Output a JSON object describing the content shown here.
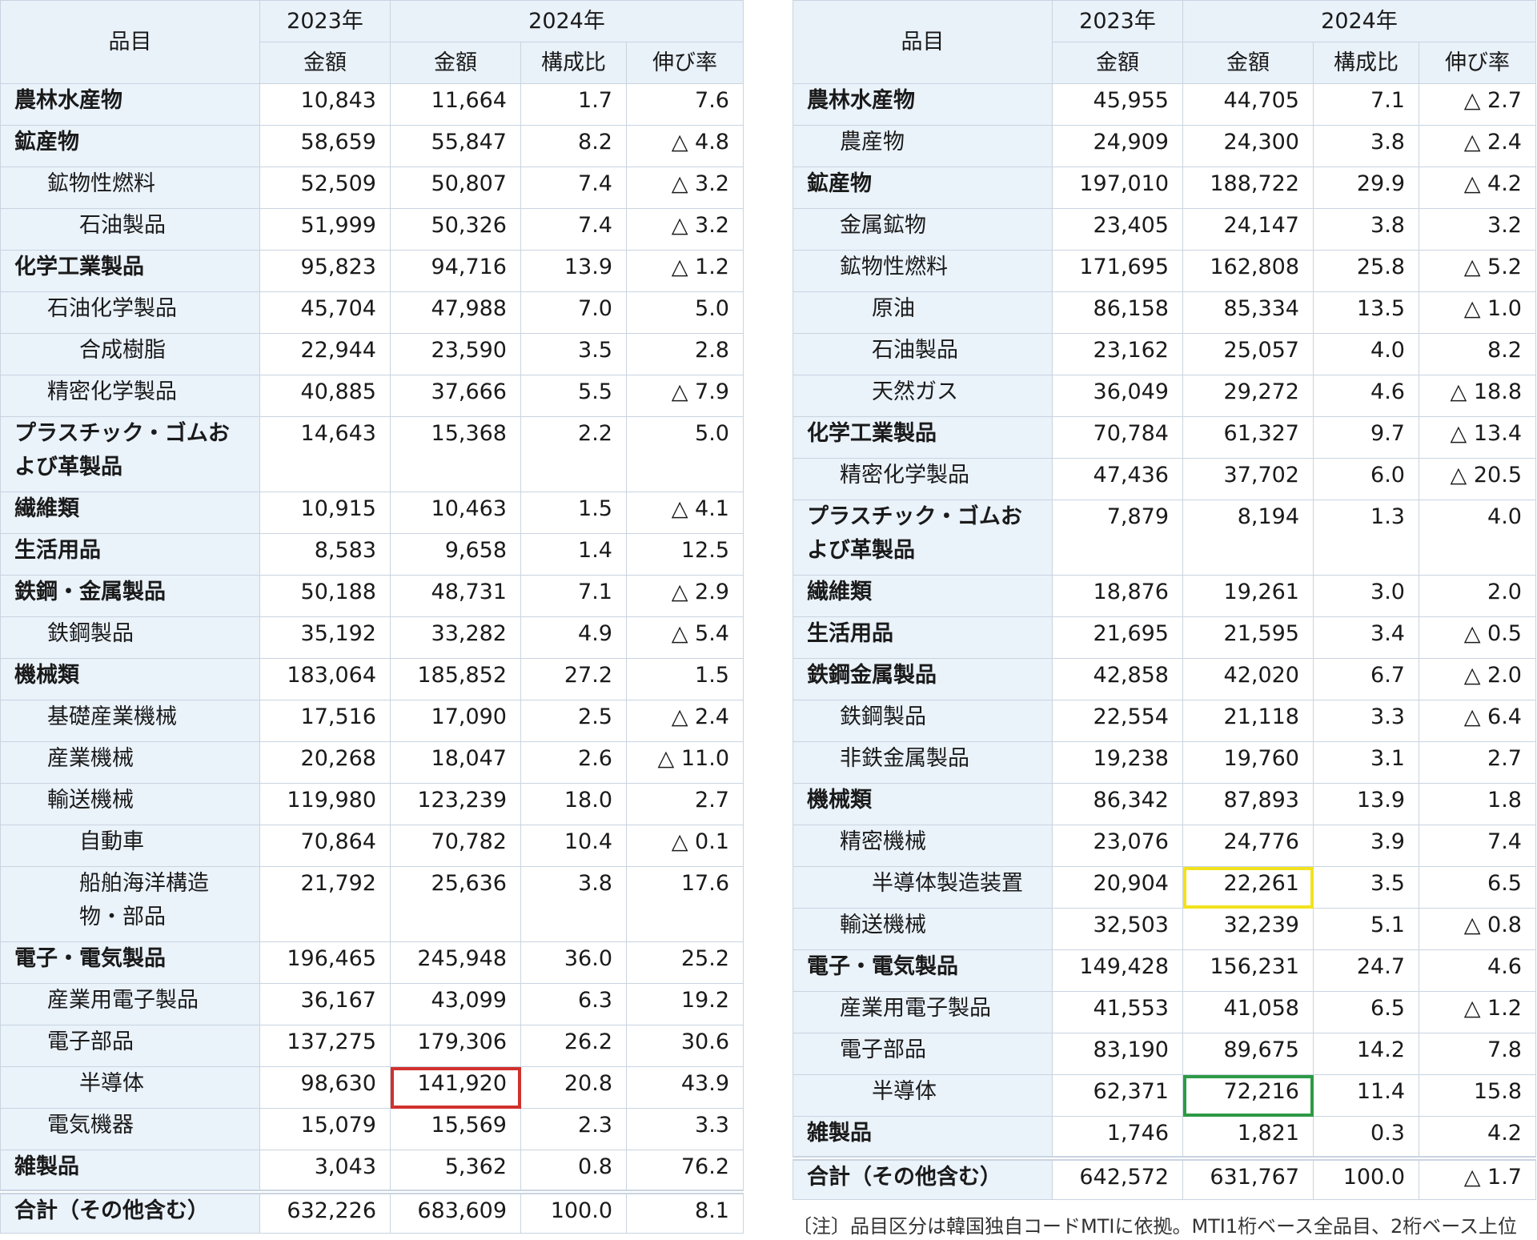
{
  "headers": {
    "item": "品目",
    "year_prev": "2023年",
    "year_curr": "2024年",
    "amount": "金額",
    "share": "構成比",
    "growth": "伸び率"
  },
  "left_table": {
    "rows": [
      {
        "name": "農林水産物",
        "level": 0,
        "v2023": "10,843",
        "v2024": "11,664",
        "share": "1.7",
        "growth": "7.6"
      },
      {
        "name": "鉱産物",
        "level": 0,
        "v2023": "58,659",
        "v2024": "55,847",
        "share": "8.2",
        "growth": "△ 4.8"
      },
      {
        "name": "鉱物性燃料",
        "level": 1,
        "v2023": "52,509",
        "v2024": "50,807",
        "share": "7.4",
        "growth": "△ 3.2"
      },
      {
        "name": "石油製品",
        "level": 2,
        "v2023": "51,999",
        "v2024": "50,326",
        "share": "7.4",
        "growth": "△ 3.2"
      },
      {
        "name": "化学工業製品",
        "level": 0,
        "v2023": "95,823",
        "v2024": "94,716",
        "share": "13.9",
        "growth": "△ 1.2"
      },
      {
        "name": "石油化学製品",
        "level": 1,
        "v2023": "45,704",
        "v2024": "47,988",
        "share": "7.0",
        "growth": "5.0"
      },
      {
        "name": "合成樹脂",
        "level": 2,
        "v2023": "22,944",
        "v2024": "23,590",
        "share": "3.5",
        "growth": "2.8"
      },
      {
        "name": "精密化学製品",
        "level": 1,
        "v2023": "40,885",
        "v2024": "37,666",
        "share": "5.5",
        "growth": "△ 7.9"
      },
      {
        "name": "プラスチック・ゴムおよび革製品",
        "level": 0,
        "v2023": "14,643",
        "v2024": "15,368",
        "share": "2.2",
        "growth": "5.0",
        "tall": true
      },
      {
        "name": "繊維類",
        "level": 0,
        "v2023": "10,915",
        "v2024": "10,463",
        "share": "1.5",
        "growth": "△ 4.1"
      },
      {
        "name": "生活用品",
        "level": 0,
        "v2023": "8,583",
        "v2024": "9,658",
        "share": "1.4",
        "growth": "12.5"
      },
      {
        "name": "鉄鋼・金属製品",
        "level": 0,
        "v2023": "50,188",
        "v2024": "48,731",
        "share": "7.1",
        "growth": "△ 2.9"
      },
      {
        "name": "鉄鋼製品",
        "level": 1,
        "v2023": "35,192",
        "v2024": "33,282",
        "share": "4.9",
        "growth": "△ 5.4"
      },
      {
        "name": "機械類",
        "level": 0,
        "v2023": "183,064",
        "v2024": "185,852",
        "share": "27.2",
        "growth": "1.5"
      },
      {
        "name": "基礎産業機械",
        "level": 1,
        "v2023": "17,516",
        "v2024": "17,090",
        "share": "2.5",
        "growth": "△ 2.4"
      },
      {
        "name": "産業機械",
        "level": 1,
        "v2023": "20,268",
        "v2024": "18,047",
        "share": "2.6",
        "growth": "△ 11.0"
      },
      {
        "name": "輸送機械",
        "level": 1,
        "v2023": "119,980",
        "v2024": "123,239",
        "share": "18.0",
        "growth": "2.7"
      },
      {
        "name": "自動車",
        "level": 2,
        "v2023": "70,864",
        "v2024": "70,782",
        "share": "10.4",
        "growth": "△ 0.1"
      },
      {
        "name": "船舶海洋構造物・部品",
        "level": 2,
        "v2023": "21,792",
        "v2024": "25,636",
        "share": "3.8",
        "growth": "17.6",
        "tall": true
      },
      {
        "name": "電子・電気製品",
        "level": 0,
        "v2023": "196,465",
        "v2024": "245,948",
        "share": "36.0",
        "growth": "25.2"
      },
      {
        "name": "産業用電子製品",
        "level": 1,
        "v2023": "36,167",
        "v2024": "43,099",
        "share": "6.3",
        "growth": "19.2"
      },
      {
        "name": "電子部品",
        "level": 1,
        "v2023": "137,275",
        "v2024": "179,306",
        "share": "26.2",
        "growth": "30.6"
      },
      {
        "name": "半導体",
        "level": 2,
        "v2023": "98,630",
        "v2024": "141,920",
        "share": "20.8",
        "growth": "43.9",
        "highlight": "red"
      },
      {
        "name": "電気機器",
        "level": 1,
        "v2023": "15,079",
        "v2024": "15,569",
        "share": "2.3",
        "growth": "3.3"
      },
      {
        "name": "雑製品",
        "level": 0,
        "v2023": "3,043",
        "v2024": "5,362",
        "share": "0.8",
        "growth": "76.2"
      }
    ],
    "total": {
      "name": "合計（その他含む）",
      "v2023": "632,226",
      "v2024": "683,609",
      "share": "100.0",
      "growth": "8.1"
    }
  },
  "right_table": {
    "rows": [
      {
        "name": "農林水産物",
        "level": 0,
        "v2023": "45,955",
        "v2024": "44,705",
        "share": "7.1",
        "growth": "△ 2.7"
      },
      {
        "name": "農産物",
        "level": 1,
        "v2023": "24,909",
        "v2024": "24,300",
        "share": "3.8",
        "growth": "△ 2.4"
      },
      {
        "name": "鉱産物",
        "level": 0,
        "v2023": "197,010",
        "v2024": "188,722",
        "share": "29.9",
        "growth": "△ 4.2"
      },
      {
        "name": "金属鉱物",
        "level": 1,
        "v2023": "23,405",
        "v2024": "24,147",
        "share": "3.8",
        "growth": "3.2"
      },
      {
        "name": "鉱物性燃料",
        "level": 1,
        "v2023": "171,695",
        "v2024": "162,808",
        "share": "25.8",
        "growth": "△ 5.2"
      },
      {
        "name": "原油",
        "level": 2,
        "v2023": "86,158",
        "v2024": "85,334",
        "share": "13.5",
        "growth": "△ 1.0"
      },
      {
        "name": "石油製品",
        "level": 2,
        "v2023": "23,162",
        "v2024": "25,057",
        "share": "4.0",
        "growth": "8.2"
      },
      {
        "name": "天然ガス",
        "level": 2,
        "v2023": "36,049",
        "v2024": "29,272",
        "share": "4.6",
        "growth": "△ 18.8"
      },
      {
        "name": "化学工業製品",
        "level": 0,
        "v2023": "70,784",
        "v2024": "61,327",
        "share": "9.7",
        "growth": "△ 13.4"
      },
      {
        "name": "精密化学製品",
        "level": 1,
        "v2023": "47,436",
        "v2024": "37,702",
        "share": "6.0",
        "growth": "△ 20.5"
      },
      {
        "name": "プラスチック・ゴムおよび革製品",
        "level": 0,
        "v2023": "7,879",
        "v2024": "8,194",
        "share": "1.3",
        "growth": "4.0",
        "tall": true
      },
      {
        "name": "繊維類",
        "level": 0,
        "v2023": "18,876",
        "v2024": "19,261",
        "share": "3.0",
        "growth": "2.0"
      },
      {
        "name": "生活用品",
        "level": 0,
        "v2023": "21,695",
        "v2024": "21,595",
        "share": "3.4",
        "growth": "△ 0.5"
      },
      {
        "name": "鉄鋼金属製品",
        "level": 0,
        "v2023": "42,858",
        "v2024": "42,020",
        "share": "6.7",
        "growth": "△ 2.0"
      },
      {
        "name": "鉄鋼製品",
        "level": 1,
        "v2023": "22,554",
        "v2024": "21,118",
        "share": "3.3",
        "growth": "△ 6.4"
      },
      {
        "name": "非鉄金属製品",
        "level": 1,
        "v2023": "19,238",
        "v2024": "19,760",
        "share": "3.1",
        "growth": "2.7"
      },
      {
        "name": "機械類",
        "level": 0,
        "v2023": "86,342",
        "v2024": "87,893",
        "share": "13.9",
        "growth": "1.8"
      },
      {
        "name": "精密機械",
        "level": 1,
        "v2023": "23,076",
        "v2024": "24,776",
        "share": "3.9",
        "growth": "7.4"
      },
      {
        "name": "半導体製造装置",
        "level": 2,
        "v2023": "20,904",
        "v2024": "22,261",
        "share": "3.5",
        "growth": "6.5",
        "highlight": "yellow"
      },
      {
        "name": "輸送機械",
        "level": 1,
        "v2023": "32,503",
        "v2024": "32,239",
        "share": "5.1",
        "growth": "△ 0.8"
      },
      {
        "name": "電子・電気製品",
        "level": 0,
        "v2023": "149,428",
        "v2024": "156,231",
        "share": "24.7",
        "growth": "4.6"
      },
      {
        "name": "産業用電子製品",
        "level": 1,
        "v2023": "41,553",
        "v2024": "41,058",
        "share": "6.5",
        "growth": "△ 1.2"
      },
      {
        "name": "電子部品",
        "level": 1,
        "v2023": "83,190",
        "v2024": "89,675",
        "share": "14.2",
        "growth": "7.8"
      },
      {
        "name": "半導体",
        "level": 2,
        "v2023": "62,371",
        "v2024": "72,216",
        "share": "11.4",
        "growth": "15.8",
        "highlight": "green"
      },
      {
        "name": "雑製品",
        "level": 0,
        "v2023": "1,746",
        "v2024": "1,821",
        "share": "0.3",
        "growth": "4.2"
      }
    ],
    "total": {
      "name": "合計（その他含む）",
      "v2023": "642,572",
      "v2024": "631,767",
      "share": "100.0",
      "growth": "△ 1.7"
    }
  },
  "note": "〔注〕品目区分は韓国独自コードMTIに依拠。MTI1桁ベース全品目、2桁ベース上位"
}
